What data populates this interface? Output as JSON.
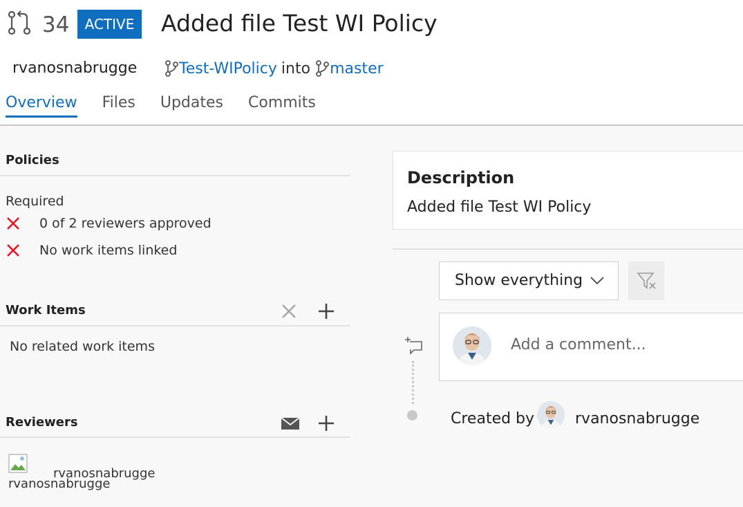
{
  "header": {
    "pr_icon": "pull-request-icon",
    "pr_id": "34",
    "status": "ACTIVE",
    "title": "Added file Test WI Policy",
    "author": "rvanosnabrugge",
    "source_branch": "Test-WIPolicy",
    "into": "into",
    "target_branch": "master",
    "branch_icon": "branch-icon"
  },
  "tabs": [
    {
      "label": "Overview",
      "active": true
    },
    {
      "label": "Files"
    },
    {
      "label": "Updates"
    },
    {
      "label": "Commits"
    }
  ],
  "policies": {
    "heading": "Policies",
    "required_label": "Required",
    "items": [
      {
        "text": "0 of 2 reviewers approved",
        "status": "failed"
      },
      {
        "text": "No work items linked",
        "status": "failed"
      }
    ]
  },
  "work_items": {
    "heading": "Work Items",
    "empty_text": "No related work items"
  },
  "reviewers": {
    "heading": "Reviewers",
    "items": [
      {
        "image_alt": "rvanosnabrugge",
        "name": "rvanosnabrugge"
      }
    ]
  },
  "description": {
    "heading": "Description",
    "text": "Added file Test WI Policy"
  },
  "activity": {
    "filter_value": "Show everything",
    "comment_placeholder": "Add a comment...",
    "created_by_label": "Created by",
    "created_by_name": "rvanosnabrugge"
  },
  "colors": {
    "accent": "#106ebe",
    "error": "#e81123"
  }
}
